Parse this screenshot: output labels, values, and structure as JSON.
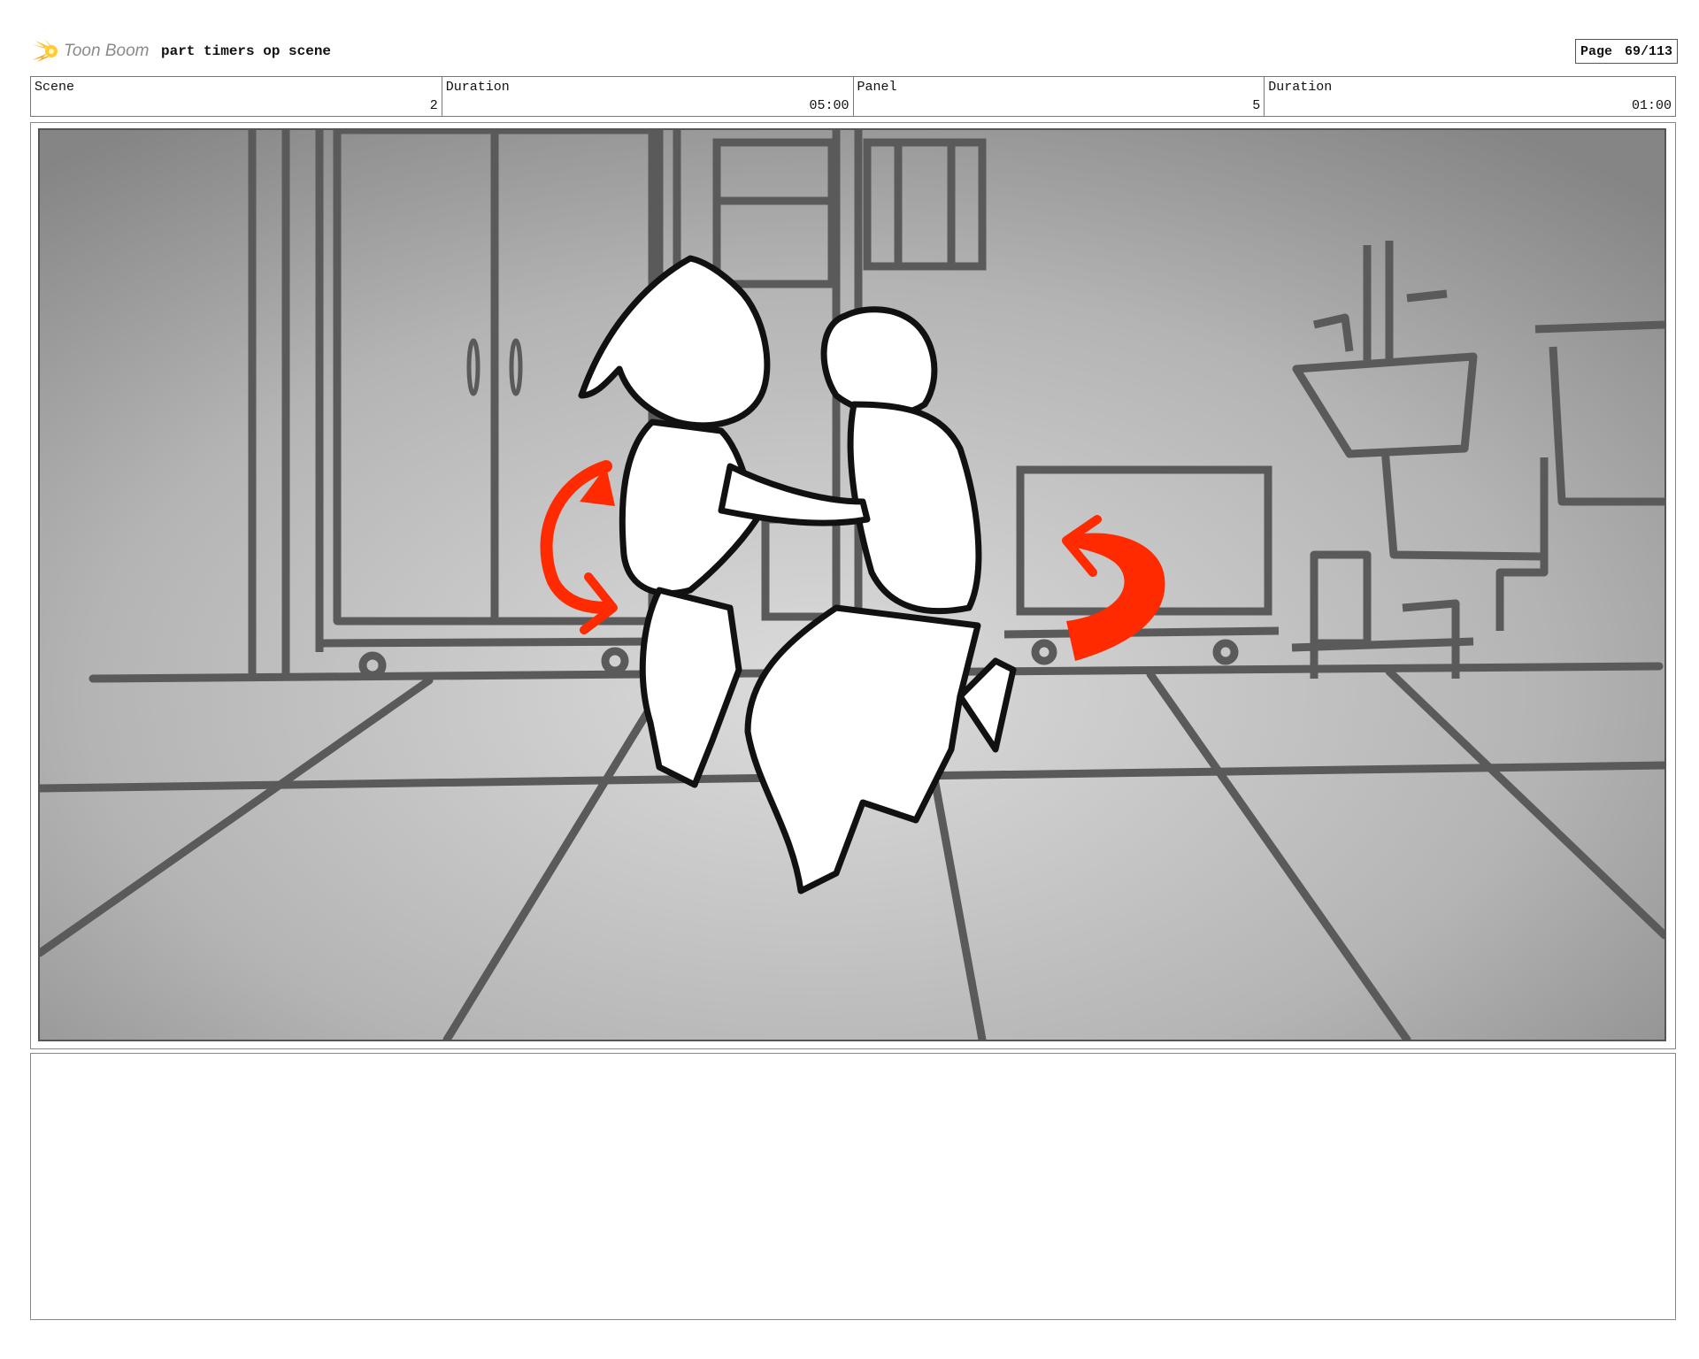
{
  "header": {
    "logo_text": "Toon Boom",
    "project_title": "part timers op scene",
    "page_label": "Page",
    "page_value": "69/113"
  },
  "info": {
    "scene_label": "Scene",
    "scene_value": "2",
    "scene_duration_label": "Duration",
    "scene_duration_value": "05:00",
    "panel_label": "Panel",
    "panel_value": "5",
    "panel_duration_label": "Duration",
    "panel_duration_value": "01:00"
  },
  "colors": {
    "arrow_red": "#ff2a00",
    "line_gray": "#555555",
    "bg_light": "#d6d6d6",
    "bg_dark": "#8a8a8a"
  },
  "notes": {
    "text": ""
  }
}
